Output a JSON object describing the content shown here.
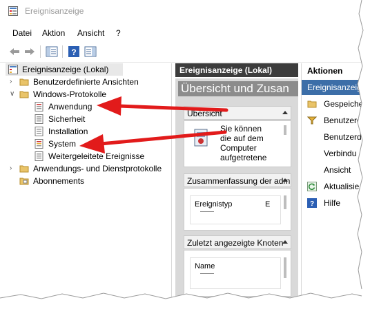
{
  "window": {
    "title": "Ereignisanzeige"
  },
  "menu": [
    "Datei",
    "Aktion",
    "Ansicht",
    "?"
  ],
  "tree": {
    "root": "Ereignisanzeige (Lokal)",
    "custom_views": "Benutzerdefinierte Ansichten",
    "windows_logs": "Windows-Protokolle",
    "logs": [
      "Anwendung",
      "Sicherheit",
      "Installation",
      "System",
      "Weitergeleitete Ereignisse"
    ],
    "app_service_logs": "Anwendungs- und Dienstprotokolle",
    "subscriptions": "Abonnements"
  },
  "middle": {
    "header": "Ereignisanzeige (Lokal)",
    "overview_title": "Übersicht und Zusan",
    "sections": {
      "overview": {
        "title": "Übersicht",
        "text": [
          "Sie können",
          "die auf dem",
          "Computer",
          "aufgetretene"
        ]
      },
      "summary": {
        "title": "Zusammenfassung der administrativen",
        "col1": "Ereignistyp",
        "col2": "E"
      },
      "recent": {
        "title": "Zuletzt angezeigte Knoten",
        "col1": "Name"
      }
    }
  },
  "actions": {
    "header": "Aktionen",
    "subheader": "Ereignisanzeige",
    "items": [
      "Gespeiche",
      "Benutzerd",
      "Benutzerd",
      "Verbindu",
      "Ansicht",
      "Aktualisie",
      "Hilfe"
    ]
  },
  "colors": {
    "arrow": "#e21b1b",
    "actions_band": "#3c6ea8",
    "mid_header": "#3c3c3c"
  }
}
